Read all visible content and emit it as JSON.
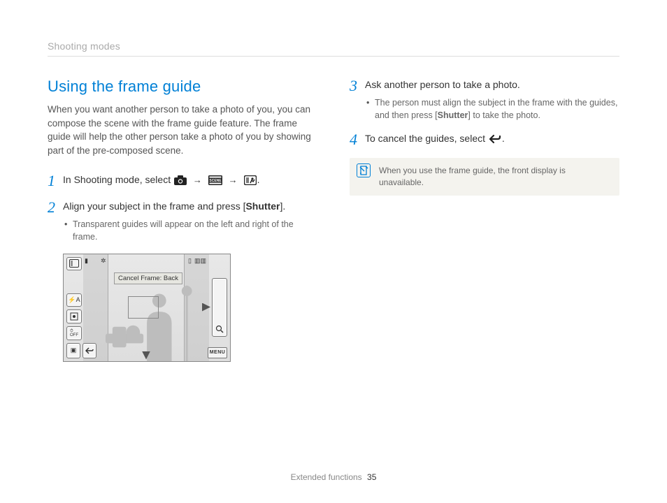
{
  "header": {
    "section": "Shooting modes"
  },
  "title": "Using the frame guide",
  "intro": "When you want another person to take a photo of you, you can compose the scene with the frame guide feature. The frame guide will help the other person take a photo of you by showing part of the pre-composed scene.",
  "steps": {
    "s1": {
      "num": "1",
      "text_a": "In Shooting mode, select ",
      "text_b": "."
    },
    "s2": {
      "num": "2",
      "text_a": "Align your subject in the frame and press [",
      "bold": "Shutter",
      "text_b": "].",
      "sub": "Transparent guides will appear on the left and right of the frame."
    },
    "s3": {
      "num": "3",
      "text": "Ask another person to take a photo.",
      "sub_a": "The person must align the subject in the frame with the guides, and then press [",
      "sub_bold": "Shutter",
      "sub_b": "] to take the photo."
    },
    "s4": {
      "num": "4",
      "text_a": "To cancel the guides, select ",
      "text_b": "."
    }
  },
  "screenshot": {
    "tooltip": "Cancel Frame: Back",
    "menu": "MENU"
  },
  "note": "When you use the frame guide, the front display is unavailable.",
  "footer": {
    "label": "Extended functions",
    "page": "35"
  },
  "icons": {
    "camera": "camera-icon",
    "scene": "scene-icon",
    "frameguide": "frame-guide-icon",
    "back": "back-icon"
  }
}
